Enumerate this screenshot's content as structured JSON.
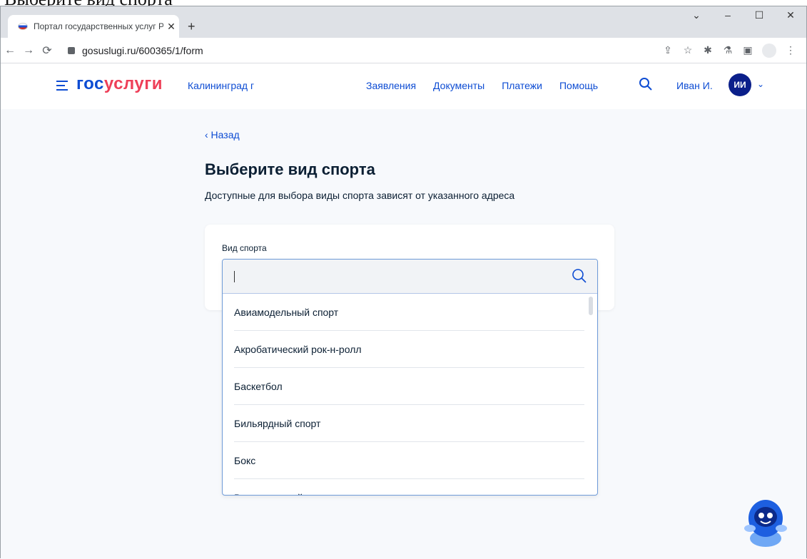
{
  "top_text": "Выберите вид спорта",
  "browser": {
    "tab_title": "Портал государственных услуг Р",
    "tab_close": "✕",
    "new_tab": "+",
    "window_controls": [
      "⌄",
      "–",
      "☐",
      "✕"
    ],
    "url": "gosuslugi.ru/600365/1/form"
  },
  "header": {
    "logo_part1": "гос",
    "logo_part2": "услуги",
    "region": "Калининград г",
    "nav": [
      "Заявления",
      "Документы",
      "Платежи",
      "Помощь"
    ],
    "user_name": "Иван И.",
    "user_initials": "ИИ"
  },
  "page": {
    "back_link": "‹ Назад",
    "title": "Выберите вид спорта",
    "subtitle": "Доступные для выбора виды спорта зависят от указанного адреса",
    "field_label": "Вид спорта",
    "search_value": "",
    "options": [
      "Авиамодельный спорт",
      "Акробатический рок-н-ролл",
      "Баскетбол",
      "Бильярдный спорт",
      "Бокс",
      "Велосипедный спорт"
    ]
  },
  "colors": {
    "brand_blue": "#0d4cd3",
    "brand_red": "#ee3f58",
    "avatar": "#0b1f8a"
  }
}
